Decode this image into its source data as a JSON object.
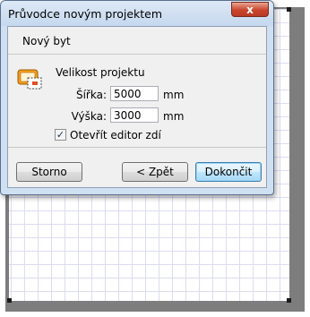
{
  "dialog": {
    "title": "Průvodce novým projektem",
    "close_label": "x",
    "header": "Nový byt",
    "section_label": "Velikost projektu",
    "width": {
      "label": "Šířka:",
      "value": "5000",
      "unit": "mm"
    },
    "height": {
      "label": "Výška:",
      "value": "3000",
      "unit": "mm"
    },
    "open_wall_editor": {
      "label": "Otevřít editor zdí",
      "checked": true,
      "mark": "✓"
    },
    "buttons": {
      "cancel": "Storno",
      "back": "< Zpět",
      "finish": "Dokončit"
    }
  },
  "icons": {
    "project": "project-size-icon",
    "close": "close-icon"
  },
  "colors": {
    "titlebar": "#c5d8ee",
    "close_button": "#c9452d",
    "canvas_frame": "#7d7d7d",
    "grid_line": "#dcdcf2",
    "default_button_border": "#3c7fb1"
  }
}
